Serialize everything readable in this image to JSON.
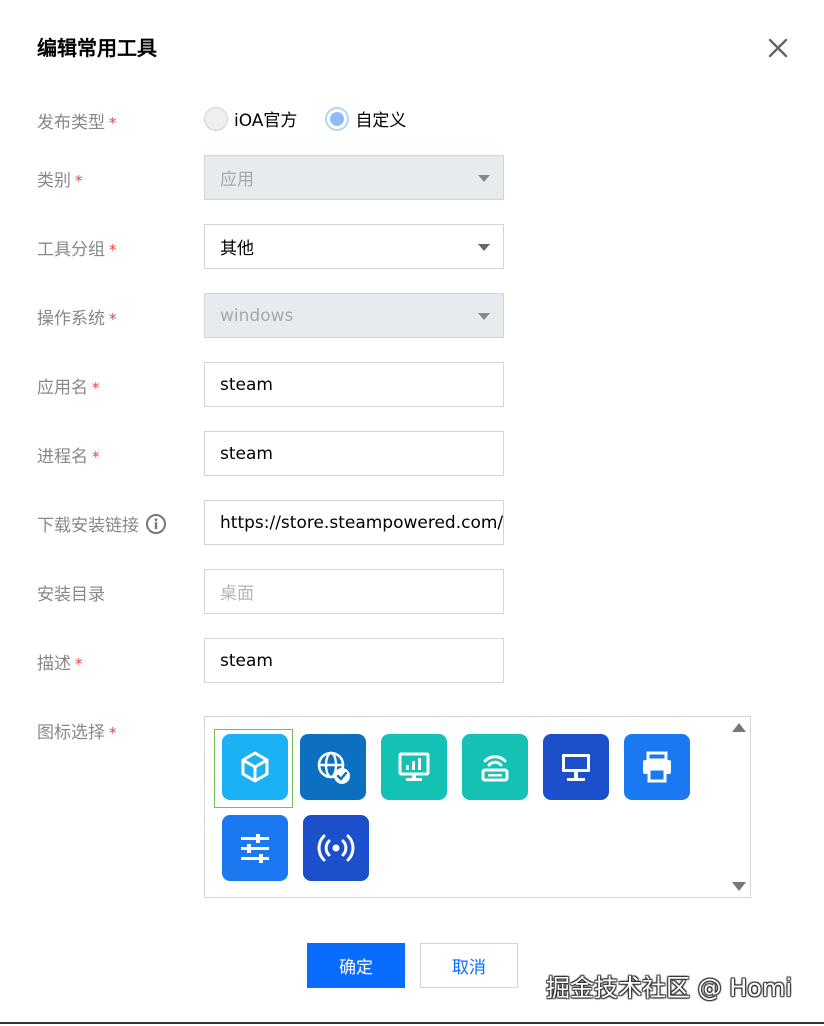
{
  "dialog": {
    "title": "编辑常用工具",
    "required_mark": "*"
  },
  "form": {
    "publish_type": {
      "label": "发布类型",
      "options": [
        "iOA官方",
        "自定义"
      ],
      "selected": "自定义"
    },
    "category": {
      "label": "类别",
      "value": "应用",
      "disabled": true
    },
    "tool_group": {
      "label": "工具分组",
      "value": "其他"
    },
    "os": {
      "label": "操作系统",
      "value": "windows",
      "disabled": true
    },
    "app_name": {
      "label": "应用名",
      "value": "steam"
    },
    "process_name": {
      "label": "进程名",
      "value": "steam"
    },
    "download_link": {
      "label": "下载安装链接",
      "value": "https://store.steampowered.com/a"
    },
    "install_dir": {
      "label": "安装目录",
      "placeholder": "桌面"
    },
    "description": {
      "label": "描述",
      "value": "steam"
    },
    "icon_select": {
      "label": "图标选择",
      "selected_index": 0,
      "icons": [
        {
          "name": "cube-icon",
          "bg": "#1ab2f5"
        },
        {
          "name": "globe-check-icon",
          "bg": "#0d6fbf"
        },
        {
          "name": "monitor-chart-icon",
          "bg": "#13c2b4"
        },
        {
          "name": "router-icon",
          "bg": "#13c2b4"
        },
        {
          "name": "desktop-icon",
          "bg": "#1c4fcc"
        },
        {
          "name": "printer-icon",
          "bg": "#1a78f0"
        },
        {
          "name": "sliders-icon",
          "bg": "#1a78f0"
        },
        {
          "name": "broadcast-icon",
          "bg": "#1c4fcc"
        }
      ]
    }
  },
  "buttons": {
    "ok": "确定",
    "cancel": "取消"
  },
  "watermark": "掘金技术社区 @ Homi",
  "colors": {
    "primary": "#0a6cff",
    "required": "#e54545",
    "selected_frame": "#6fbf5a"
  }
}
